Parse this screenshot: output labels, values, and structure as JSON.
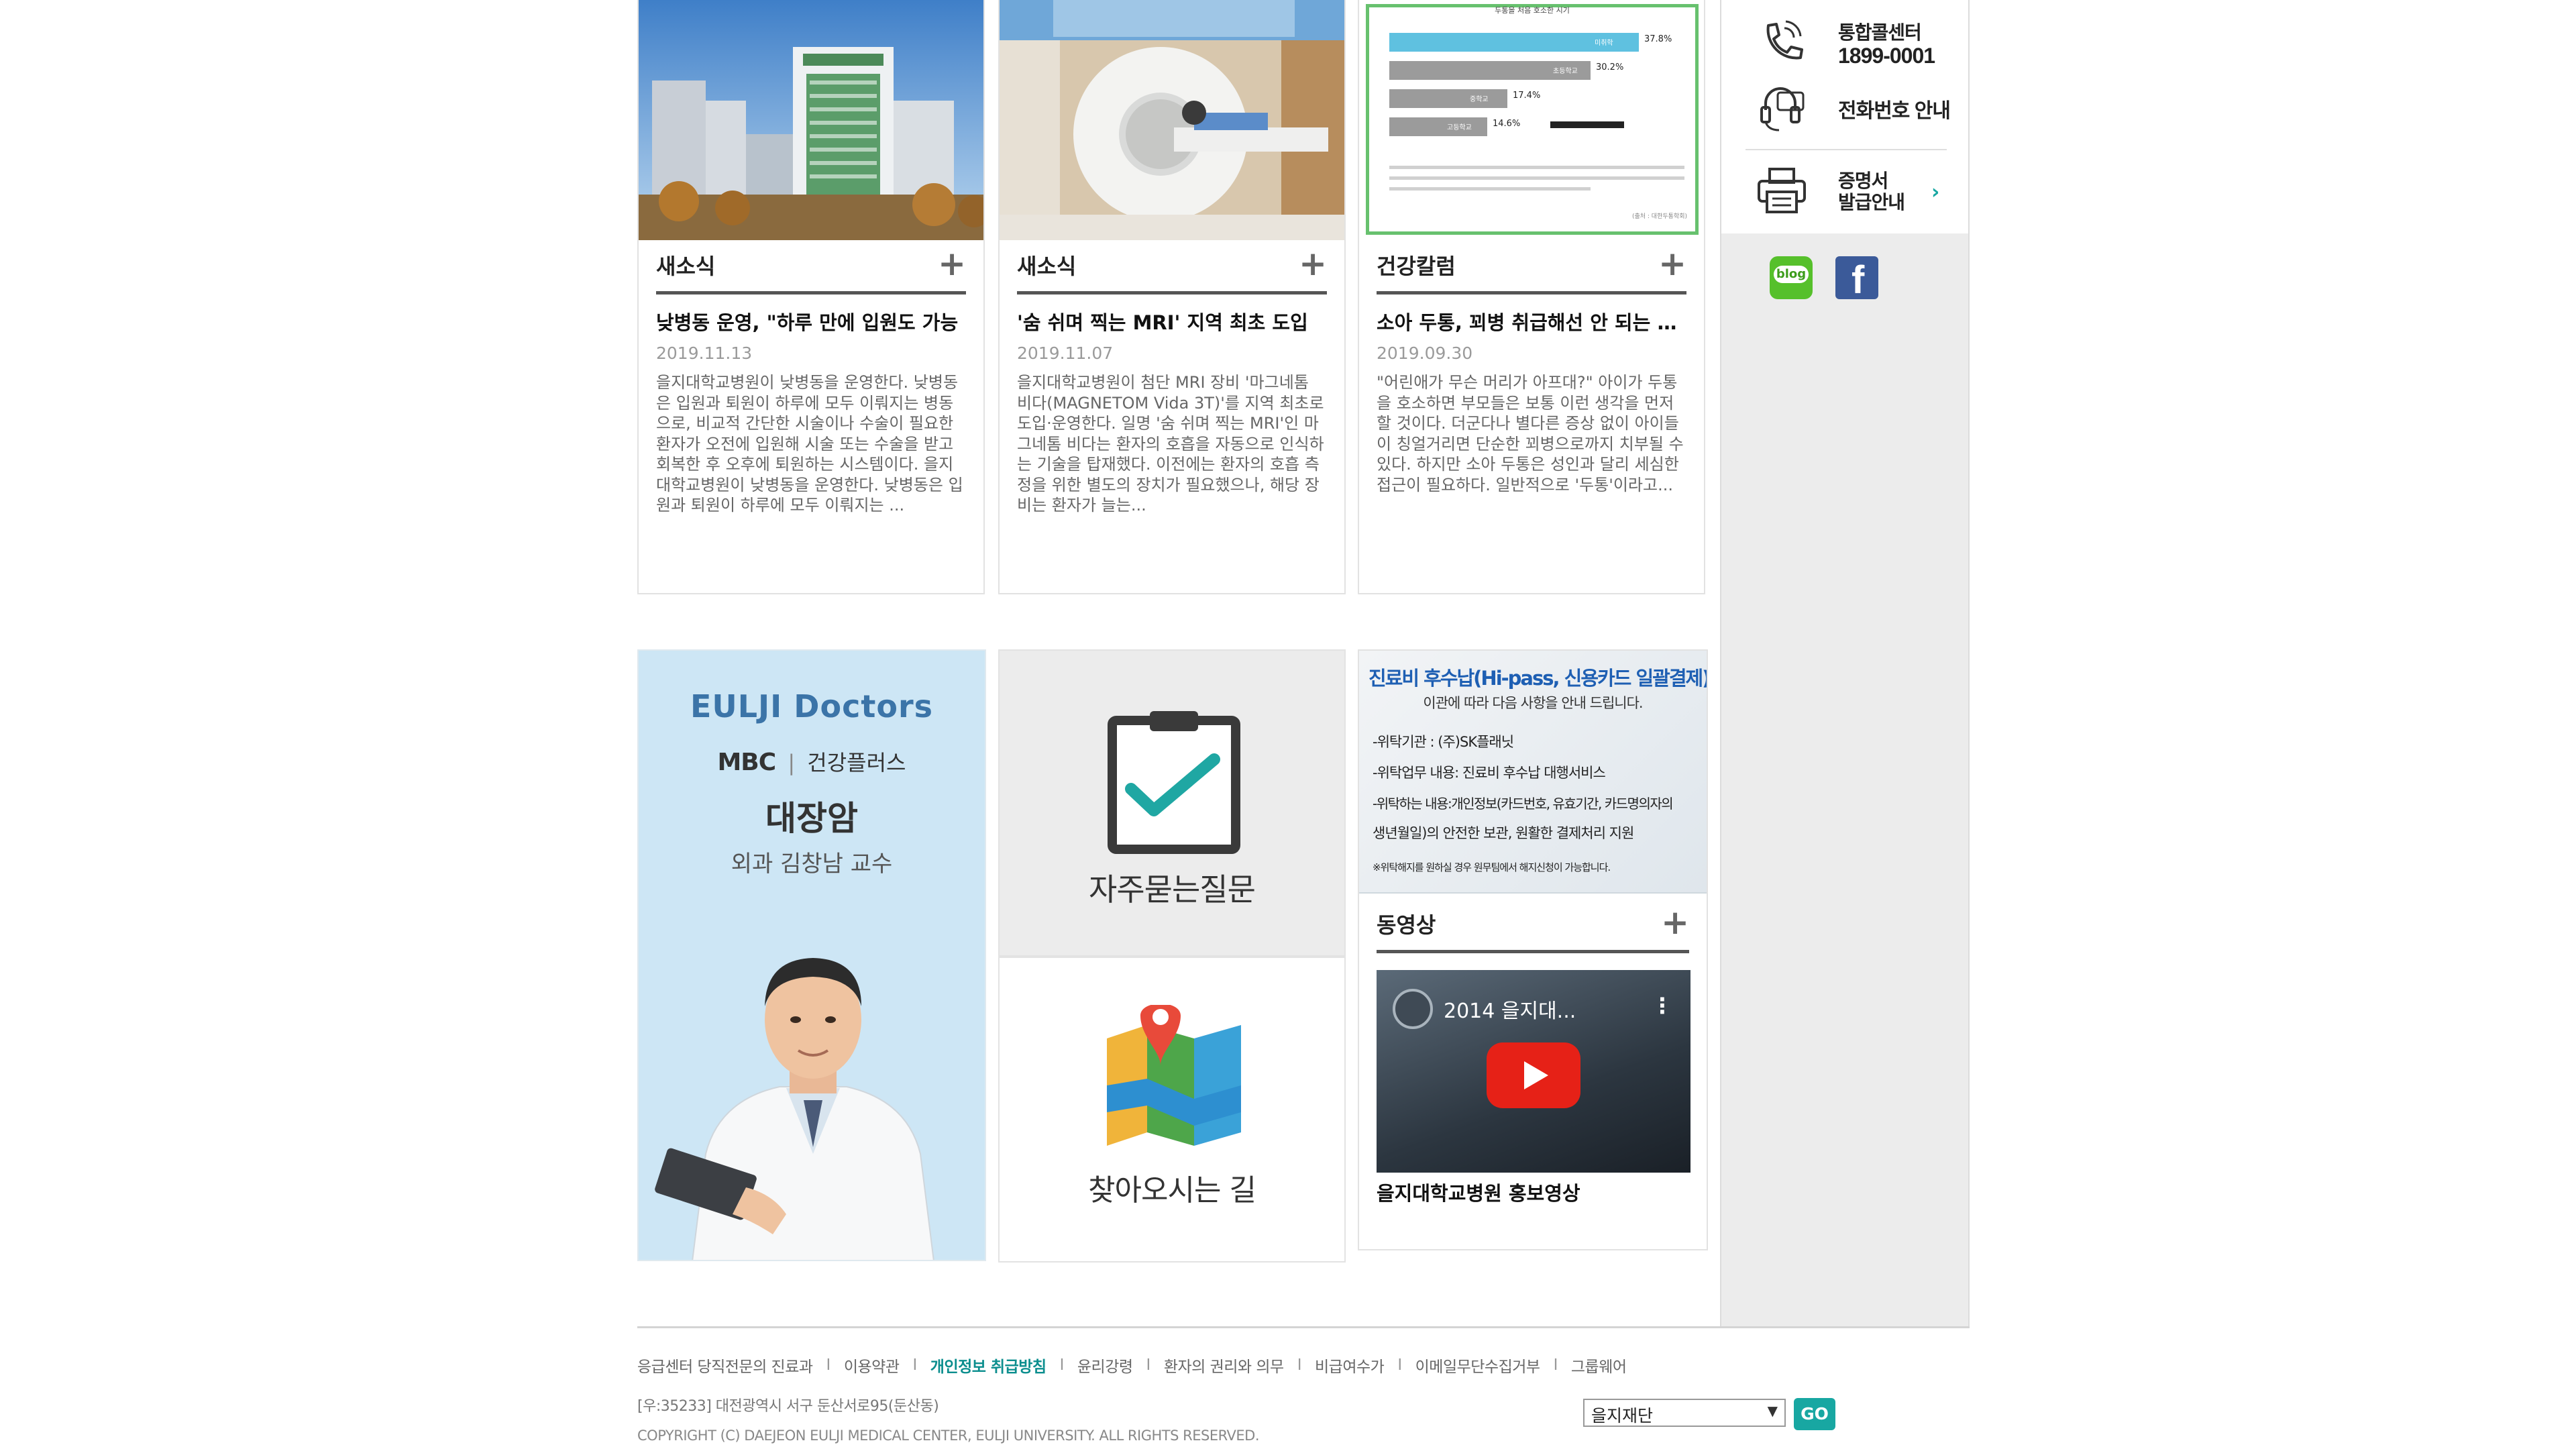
{
  "news_cards": [
    {
      "category": "새소식",
      "title": "낮병동 운영, \"하루 만에 입원도 가능",
      "date": "2019.11.13",
      "summary": "을지대학교병원이 낮병동을 운영한다. 낮병동은 입원과 퇴원이 하루에 모두 이뤄지는 병동으로, 비교적 간단한 시술이나 수술이 필요한 환자가 오전에 입원해 시술 또는 수술을 받고 회복한 후 오후에 퇴원하는 시스템이다. 을지대학교병원이 낮병동을 운영한다. 낮병동은 입원과 퇴원이 하루에 모두 이뤄지는 ..."
    },
    {
      "category": "새소식",
      "title": "'숨 쉬며 찍는 MRI' 지역 최초 도입",
      "date": "2019.11.07",
      "summary": "을지대학교병원이 첨단 MRI 장비 '마그네톰 비다(MAGNETOM Vida 3T)'를 지역 최초로 도입·운영한다. 일명 '숨 쉬며 찍는 MRI'인 마그네톰 비다는 환자의 호흡을 자동으로 인식하는 기술을 탑재했다. 이전에는 환자의 호흡 측정을 위한 별도의 장치가 필요했으나, 해당 장비는 환자가 늘는..."
    },
    {
      "category": "건강칼럼",
      "title": "소아 두통, 꾀병 취급해선 안 되는 이유",
      "date": "2019.09.30",
      "summary": "\"어린애가 무슨 머리가 아프대?\" 아이가 두통을 호소하면 부모들은 보통 이런 생각을 먼저 할 것이다. 더군다나 별다른 증상 없이 아이들이 칭얼거리면 단순한 꾀병으로까지 치부될 수 있다. 하지만 소아 두통은 성인과 달리 세심한 접근이 필요하다. 일반적으로 '두통'이라고..."
    }
  ],
  "chart_card": {
    "heading": "두통을 처음 호소한 시기",
    "bars": [
      {
        "label": "미취학",
        "value": "37.8%"
      },
      {
        "label": "초등학교",
        "value": "30.2%"
      },
      {
        "label": "중학교",
        "value": "17.4%"
      },
      {
        "label": "고등학교",
        "value": "14.6%"
      }
    ],
    "source": "(출처 : 대한두통학회)"
  },
  "sidebar": {
    "call_center_label": "통합콜센터",
    "call_center_number": "1899-0001",
    "phone_guide": "전화번호 안내",
    "certificate_line1": "증명서",
    "certificate_line2": "발급안내",
    "blog_label": "blog",
    "facebook_label": "f"
  },
  "doctors_tile": {
    "brand": "EULJI Doctors",
    "mbc": "MBC",
    "program": "건강플러스",
    "topic": "대장암",
    "doctor": "외과 김창남 교수"
  },
  "faq_tile": {
    "label": "자주묻는질문"
  },
  "map_tile": {
    "label": "찾아오시는 길"
  },
  "notice_banner": {
    "title": "진료비 후수납(Hi-pass, 신용카드 일괄결제)정보",
    "subtitle": "이관에 따라 다음 사항을 안내 드립니다.",
    "lines": [
      "-위탁기관 : (주)SK플래닛",
      "-위탁업무 내용: 진료비 후수납 대행서비스",
      "-위탁하는 내용:개인정보(카드번호, 유효기간, 카드명의자의",
      "생년월일)의 안전한 보관, 원활한 결제처리 지원",
      "※위탁해지를 원하실 경우 원무팀에서 해지신청이 가능합니다."
    ]
  },
  "video_card": {
    "category": "동영상",
    "video_title": "2014 을지대...",
    "caption": "을지대학교병원 홍보영상"
  },
  "footer": {
    "links": [
      "응급센터 당직전문의 진료과",
      "이용약관",
      "개인정보 취급방침",
      "윤리강령",
      "환자의 권리와 의무",
      "비급여수가",
      "이메일무단수집거부",
      "그룹웨어"
    ],
    "separator": "I",
    "address": "[우:35233] 대전광역시 서구 둔산서로95(둔산동)",
    "copyright": "COPYRIGHT (C) DAEJEON EULJI MEDICAL CENTER, EULJI UNIVERSITY. ALL RIGHTS RESERVED.",
    "family_select": "을지재단",
    "go_label": "GO"
  },
  "colors": {
    "accent": "#18a7a2",
    "highlight_link": "#0b8e8e",
    "sidebar_bg": "#ececec",
    "youtube_red": "#e62117"
  }
}
